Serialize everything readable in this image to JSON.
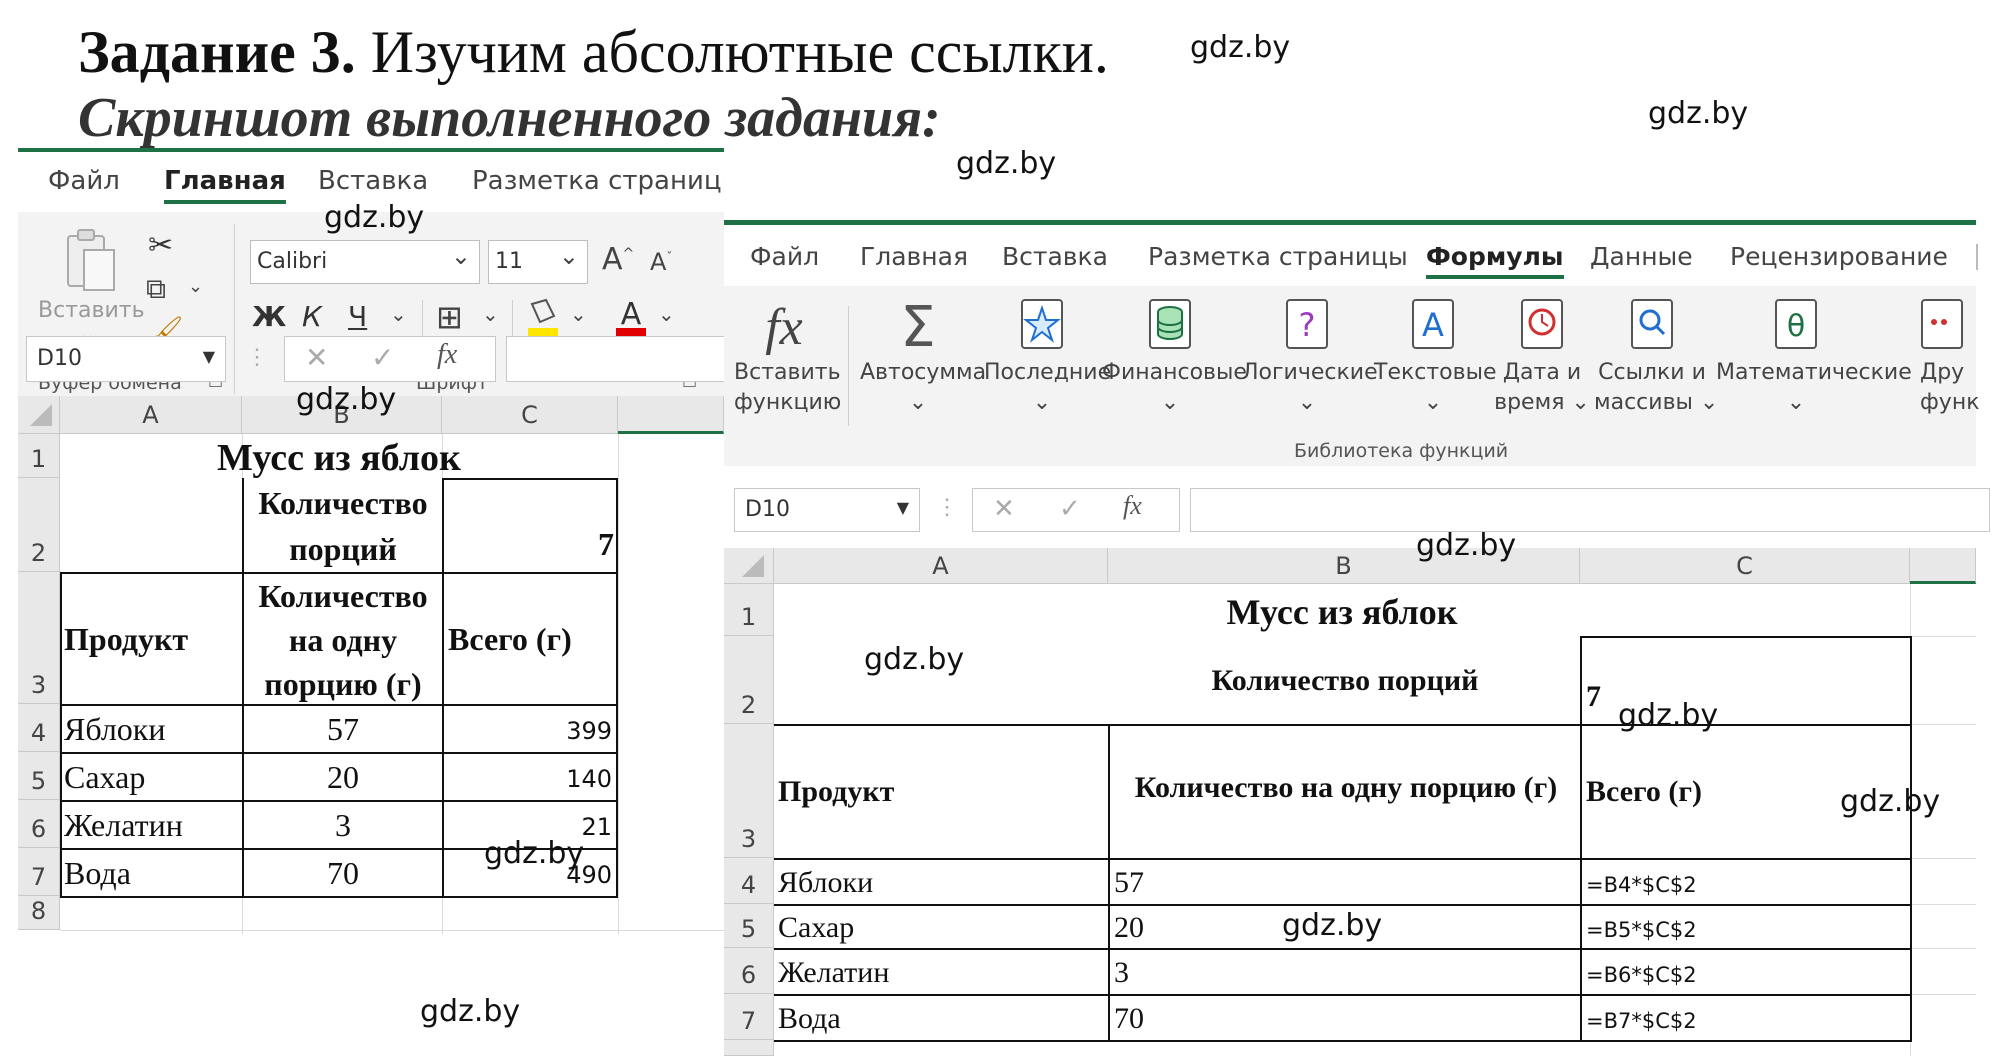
{
  "heading": {
    "task_label": "Задание 3.",
    "task_text": " Изучим абсолютные ссылки.",
    "subtitle": "Скриншот выполненного задания:"
  },
  "watermark": "gdz.by",
  "colors": {
    "excel_green": "#1e7145",
    "ribbon_bg": "#f3f3f3"
  },
  "left": {
    "tabs": [
      "Файл",
      "Главная",
      "Вставка",
      "Разметка страницы"
    ],
    "active_tab": "Главная",
    "clipboard": {
      "paste_label": "Вставить",
      "group_label": "Буфер обмена"
    },
    "font": {
      "family": "Calibri",
      "size": "11",
      "group_label": "Шрифт"
    },
    "namebox": "D10",
    "columns": [
      "A",
      "B",
      "C"
    ],
    "rows": [
      "1",
      "2",
      "3",
      "4",
      "5",
      "6",
      "7",
      "8"
    ],
    "sheet": {
      "title": "Мусс из яблок",
      "portions_label": "Количество порций",
      "portions_value": "7",
      "col_product": "Продукт",
      "col_per_portion": "Количество на одну порцию (г)",
      "col_total": "Всего (г)",
      "items": [
        {
          "name": "Яблоки",
          "qty": "57",
          "total": "399"
        },
        {
          "name": "Сахар",
          "qty": "20",
          "total": "140"
        },
        {
          "name": "Желатин",
          "qty": "3",
          "total": "21"
        },
        {
          "name": "Вода",
          "qty": "70",
          "total": "490"
        }
      ]
    }
  },
  "right": {
    "tabs": [
      "Файл",
      "Главная",
      "Вставка",
      "Разметка страницы",
      "Формулы",
      "Данные",
      "Рецензирование"
    ],
    "active_tab": "Формулы",
    "ribbon_buttons": [
      {
        "label1": "Вставить",
        "label2": "функцию",
        "icon": "fx-icon"
      },
      {
        "label1": "Автосумма",
        "label2": "⌄",
        "icon": "sigma-icon"
      },
      {
        "label1": "Последние",
        "label2": "⌄",
        "icon": "star-book-icon"
      },
      {
        "label1": "Финансовые",
        "label2": "⌄",
        "icon": "database-book-icon"
      },
      {
        "label1": "Логические",
        "label2": "⌄",
        "icon": "question-book-icon"
      },
      {
        "label1": "Текстовые",
        "label2": "⌄",
        "icon": "text-book-icon"
      },
      {
        "label1": "Дата и",
        "label2": "время ⌄",
        "icon": "clock-book-icon"
      },
      {
        "label1": "Ссылки и",
        "label2": "массивы ⌄",
        "icon": "search-book-icon"
      },
      {
        "label1": "Математические",
        "label2": "⌄",
        "icon": "theta-book-icon"
      },
      {
        "label1": "Дру",
        "label2": "функ",
        "icon": "more-book-icon"
      }
    ],
    "group_label": "Библиотека функций",
    "namebox": "D10",
    "columns": [
      "A",
      "B",
      "C"
    ],
    "rows": [
      "1",
      "2",
      "3",
      "4",
      "5",
      "6",
      "7"
    ],
    "sheet": {
      "title": "Мусс из яблок",
      "portions_label": "Количество порций",
      "portions_value": "7",
      "col_product": "Продукт",
      "col_per_portion": "Количество на одну порцию (г)",
      "col_total": "Всего (г)",
      "items": [
        {
          "name": "Яблоки",
          "qty": "57",
          "formula": "=B4*$C$2"
        },
        {
          "name": "Сахар",
          "qty": "20",
          "formula": "=B5*$C$2"
        },
        {
          "name": "Желатин",
          "qty": "3",
          "formula": "=B6*$C$2"
        },
        {
          "name": "Вода",
          "qty": "70",
          "formula": "=B7*$C$2"
        }
      ]
    }
  }
}
